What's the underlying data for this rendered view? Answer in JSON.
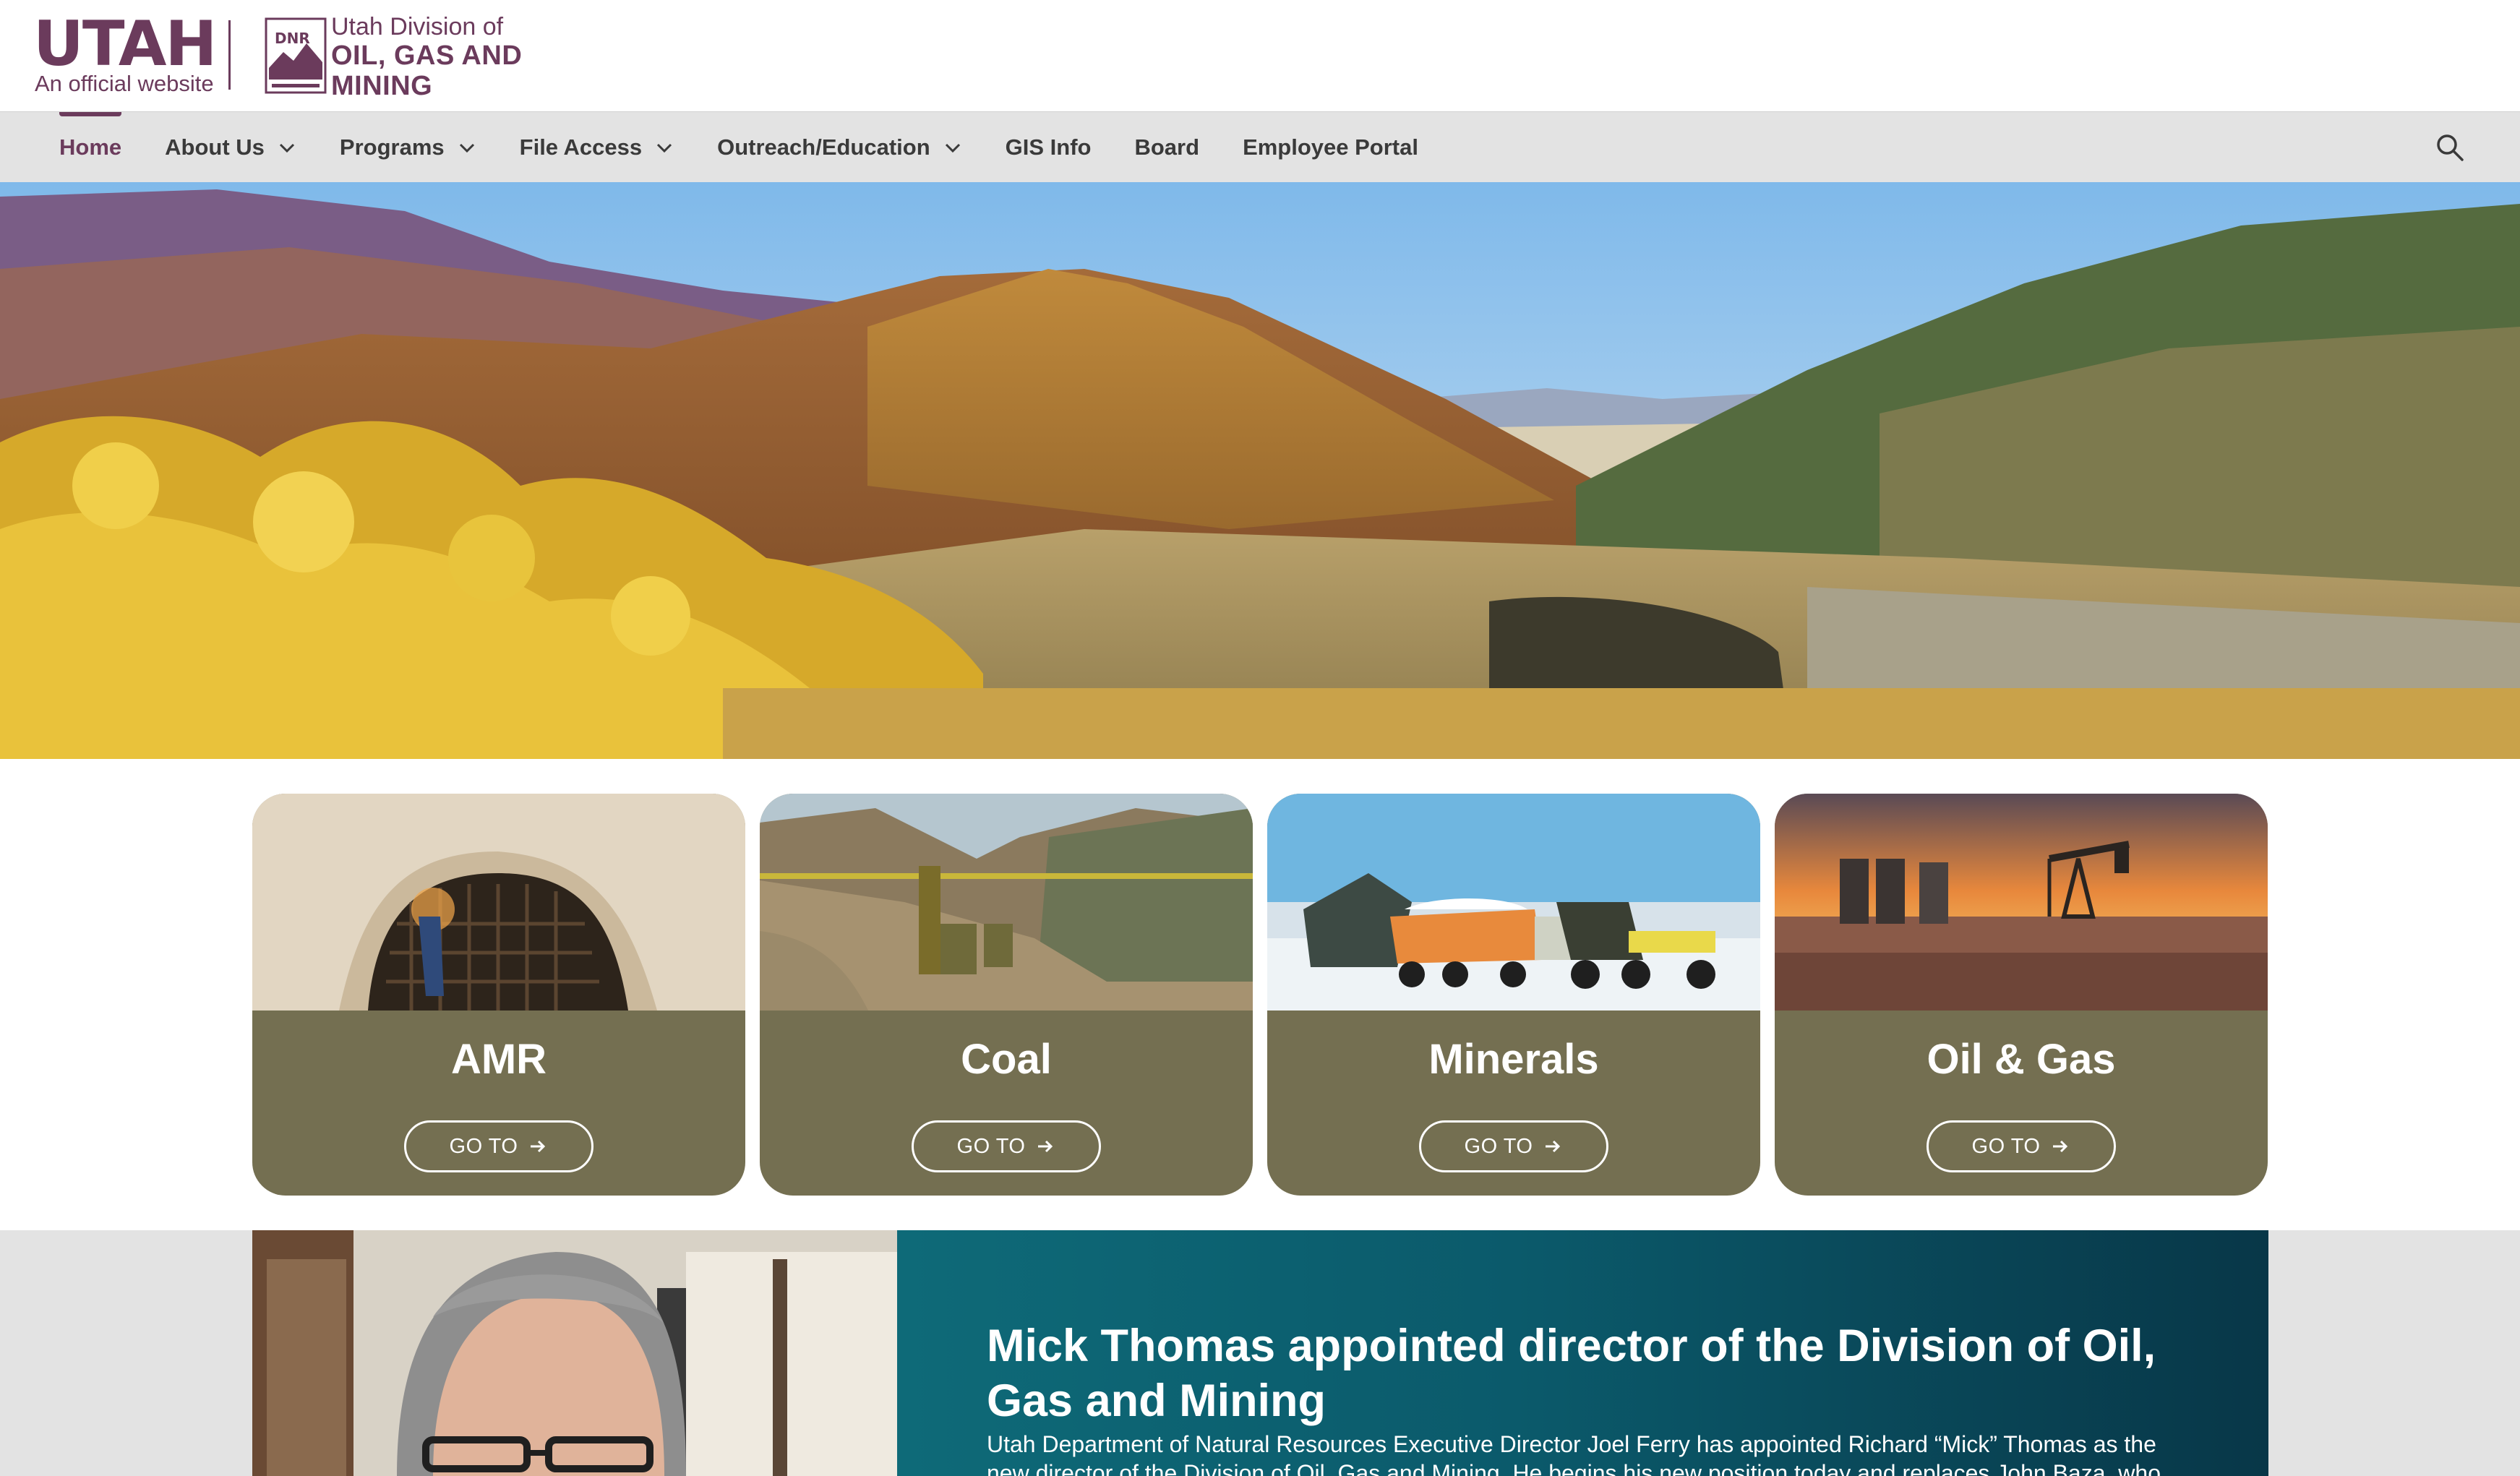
{
  "header": {
    "state_logo": "UTAH",
    "official_text": "An official website",
    "agency_mark": "DNR",
    "agency_line1": "Utah Division of",
    "agency_line2": "OIL, GAS AND",
    "agency_line3": "MINING"
  },
  "nav": {
    "items": [
      {
        "label": "Home",
        "active": true,
        "dropdown": false
      },
      {
        "label": "About Us",
        "dropdown": true
      },
      {
        "label": "Programs",
        "dropdown": true
      },
      {
        "label": "File Access",
        "dropdown": true
      },
      {
        "label": "Outreach/Education",
        "dropdown": true
      },
      {
        "label": "GIS Info",
        "dropdown": false
      },
      {
        "label": "Board",
        "dropdown": false
      },
      {
        "label": "Employee Portal",
        "dropdown": false
      }
    ],
    "search_icon": "search-icon"
  },
  "cards": [
    {
      "title": "AMR",
      "button": "GO TO"
    },
    {
      "title": "Coal",
      "button": "GO TO"
    },
    {
      "title": "Minerals",
      "button": "GO TO"
    },
    {
      "title": "Oil & Gas",
      "button": "GO TO"
    }
  ],
  "feature": {
    "title": "Mick Thomas appointed director of the Division of Oil, Gas and Mining",
    "text": "Utah Department of Natural Resources Executive Director Joel Ferry has appointed Richard “Mick” Thomas as the new director of the Division of Oil, Gas and Mining. He begins his new position today and replaces John Baza, who served as the"
  },
  "colors": {
    "brand_purple": "#6b3b5c",
    "nav_bg": "#e3e3e3",
    "card_olive": "#746f51",
    "feature_teal": "#0b5a6b"
  }
}
